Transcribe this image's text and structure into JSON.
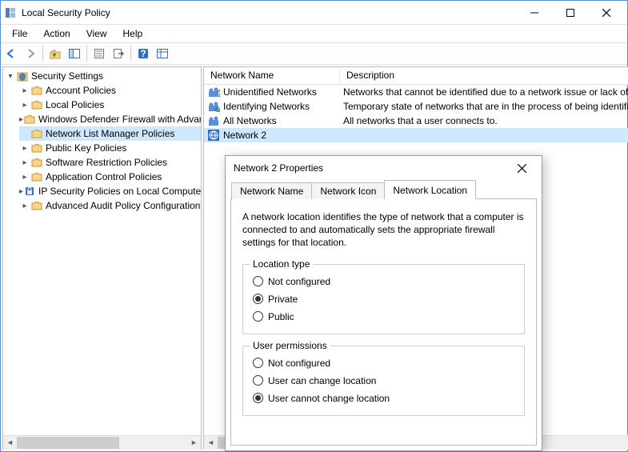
{
  "window": {
    "title": "Local Security Policy"
  },
  "menubar": [
    "File",
    "Action",
    "View",
    "Help"
  ],
  "tree": {
    "root": "Security Settings",
    "items": [
      "Account Policies",
      "Local Policies",
      "Windows Defender Firewall with Advanced Security",
      "Network List Manager Policies",
      "Public Key Policies",
      "Software Restriction Policies",
      "Application Control Policies",
      "IP Security Policies on Local Computer",
      "Advanced Audit Policy Configuration"
    ],
    "selected": 3
  },
  "list": {
    "columns": [
      "Network Name",
      "Description"
    ],
    "rows": [
      {
        "name": "Unidentified Networks",
        "desc": "Networks that cannot be identified due to a network issue or lack of identifiable characteristics."
      },
      {
        "name": "Identifying Networks",
        "desc": "Temporary state of networks that are in the process of being identified."
      },
      {
        "name": "All Networks",
        "desc": "All networks that a user connects to."
      },
      {
        "name": "Network 2",
        "desc": ""
      }
    ],
    "selected": 3
  },
  "dialog": {
    "title": "Network 2 Properties",
    "tabs": [
      "Network Name",
      "Network Icon",
      "Network Location"
    ],
    "active_tab": 2,
    "description": "A network location identifies the type of network that a computer is connected to and automatically sets the appropriate firewall settings for that location.",
    "group_location": {
      "title": "Location type",
      "options": [
        "Not configured",
        "Private",
        "Public"
      ],
      "selected": 1
    },
    "group_permissions": {
      "title": "User permissions",
      "options": [
        "Not configured",
        "User can change location",
        "User cannot change location"
      ],
      "selected": 2
    }
  }
}
